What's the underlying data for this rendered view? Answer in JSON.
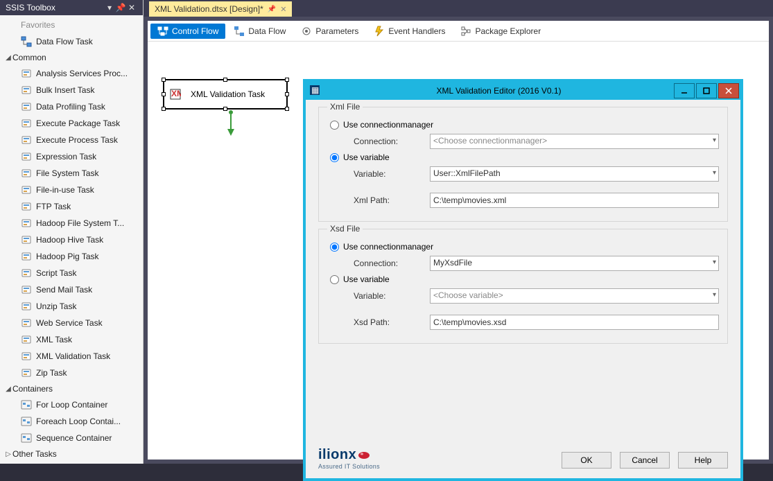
{
  "toolbox": {
    "title": "SSIS Toolbox",
    "truncated_top": "Favorites",
    "items_fav": [
      {
        "label": "Data Flow Task"
      }
    ],
    "cat_common": "Common",
    "items_common": [
      {
        "label": "Analysis Services Proc..."
      },
      {
        "label": "Bulk Insert Task"
      },
      {
        "label": "Data Profiling Task"
      },
      {
        "label": "Execute Package Task"
      },
      {
        "label": "Execute Process Task"
      },
      {
        "label": "Expression Task"
      },
      {
        "label": "File System Task"
      },
      {
        "label": "File-in-use Task"
      },
      {
        "label": "FTP Task"
      },
      {
        "label": "Hadoop File System T..."
      },
      {
        "label": "Hadoop Hive Task"
      },
      {
        "label": "Hadoop Pig Task"
      },
      {
        "label": "Script Task"
      },
      {
        "label": "Send Mail Task"
      },
      {
        "label": "Unzip Task"
      },
      {
        "label": "Web Service Task"
      },
      {
        "label": "XML Task"
      },
      {
        "label": "XML Validation Task"
      },
      {
        "label": "Zip Task"
      }
    ],
    "cat_containers": "Containers",
    "items_containers": [
      {
        "label": "For Loop Container"
      },
      {
        "label": "Foreach Loop Contai..."
      },
      {
        "label": "Sequence Container"
      }
    ],
    "cat_other": "Other Tasks"
  },
  "document_tab": "XML Validation.dtsx [Design]*",
  "designer_tabs": {
    "control_flow": "Control Flow",
    "data_flow": "Data Flow",
    "parameters": "Parameters",
    "event_handlers": "Event Handlers",
    "package_explorer": "Package Explorer"
  },
  "task_name": "XML Validation Task",
  "editor": {
    "title": "XML Validation Editor (2016 V0.1)",
    "xml_legend": "Xml File",
    "xsd_legend": "Xsd File",
    "opt_connmgr": "Use connectionmanager",
    "opt_variable": "Use variable",
    "lbl_connection": "Connection:",
    "lbl_variable": "Variable:",
    "lbl_xmlpath": "Xml Path:",
    "lbl_xsdpath": "Xsd Path:",
    "ph_connmgr": "<Choose connectionmanager>",
    "ph_variable": "<Choose variable>",
    "val_variable": "User::XmlFilePath",
    "val_xmlpath": "C:\\temp\\movies.xml",
    "val_xsdconn": "MyXsdFile",
    "val_xsdpath": "C:\\temp\\movies.xsd",
    "btn_ok": "OK",
    "btn_cancel": "Cancel",
    "btn_help": "Help",
    "logo_text": "ilionx",
    "logo_sub": "Assured IT Solutions"
  }
}
